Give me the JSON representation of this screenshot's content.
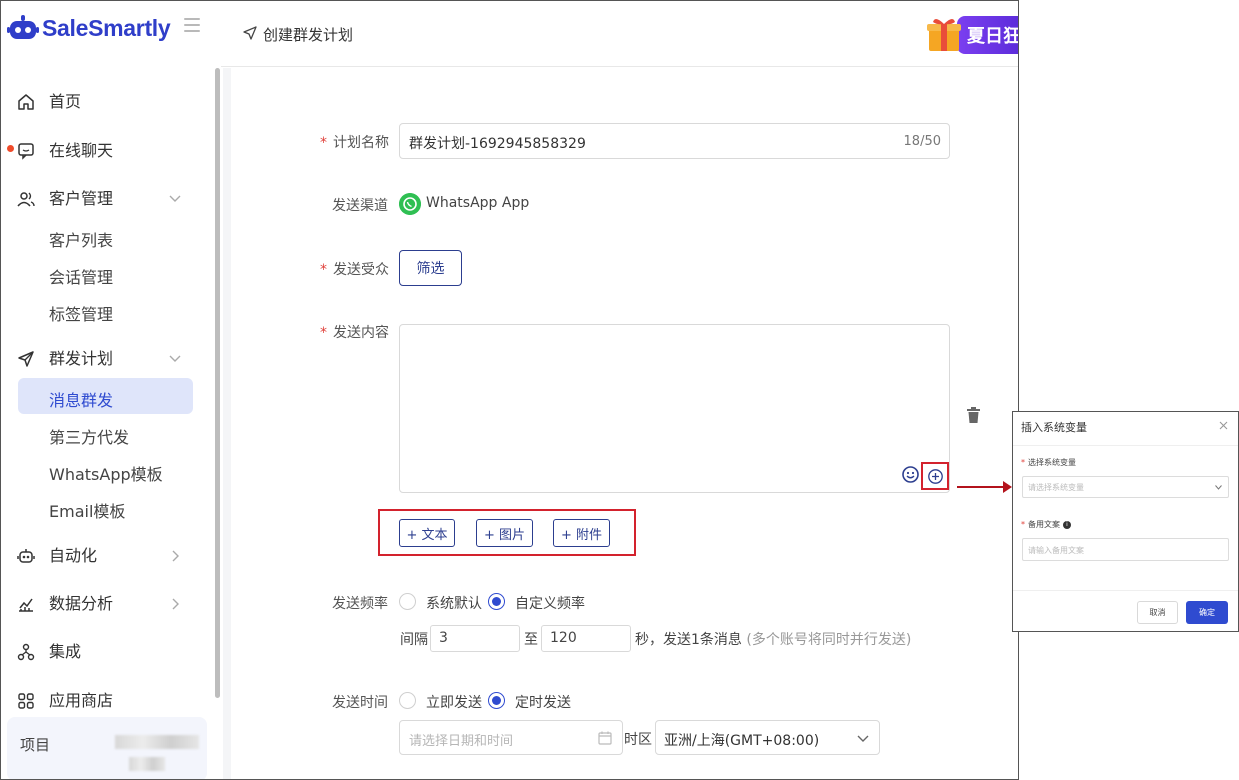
{
  "brand": {
    "name": "SaleSmartly"
  },
  "sidebar": {
    "items": [
      {
        "label": "首页",
        "icon": "home-icon"
      },
      {
        "label": "在线聊天",
        "icon": "chat-icon"
      },
      {
        "label": "客户管理",
        "icon": "users-icon",
        "children": [
          "客户列表",
          "会话管理",
          "标签管理"
        ]
      },
      {
        "label": "群发计划",
        "icon": "send-icon",
        "children": [
          "消息群发",
          "第三方代发",
          "WhatsApp模板",
          "Email模板"
        ]
      },
      {
        "label": "自动化",
        "icon": "robot-icon"
      },
      {
        "label": "数据分析",
        "icon": "chart-icon"
      },
      {
        "label": "集成",
        "icon": "integration-icon"
      },
      {
        "label": "应用商店",
        "icon": "apps-icon"
      }
    ],
    "active_sub": "消息群发",
    "project_label": "项目"
  },
  "header": {
    "title": "创建群发计划",
    "promo_text": "夏日狂"
  },
  "form": {
    "plan_name": {
      "label": "计划名称",
      "value": "群发计划-1692945858329",
      "counter": "18/50"
    },
    "channel": {
      "label": "发送渠道",
      "value": "WhatsApp App"
    },
    "audience": {
      "label": "发送受众",
      "button": "筛选"
    },
    "content": {
      "label": "发送内容",
      "add_text": "+ 文本",
      "add_image": "+ 图片",
      "add_attachment": "+ 附件"
    },
    "frequency": {
      "label": "发送频率",
      "option_default": "系统默认",
      "option_custom": "自定义频率",
      "interval_label": "间隔",
      "min": "3",
      "to": "至",
      "max": "120",
      "suffix": "秒，发送1条消息",
      "note": "(多个账号将同时并行发送)"
    },
    "send_time": {
      "label": "发送时间",
      "option_now": "立即发送",
      "option_scheduled": "定时发送",
      "date_placeholder": "请选择日期和时间",
      "tz_label": "时区",
      "tz_value": "亚洲/上海(GMT+08:00)"
    }
  },
  "modal": {
    "title": "插入系统变量",
    "select_label": "选择系统变量",
    "select_placeholder": "请选择系统变量",
    "fallback_label": "备用文案",
    "fallback_placeholder": "请输入备用文案",
    "cancel": "取消",
    "confirm": "确定"
  },
  "colors": {
    "brand": "#2f3ec9",
    "accent": "#2f4bd0",
    "highlight": "#d3222d",
    "whatsapp": "#2fbf53"
  }
}
